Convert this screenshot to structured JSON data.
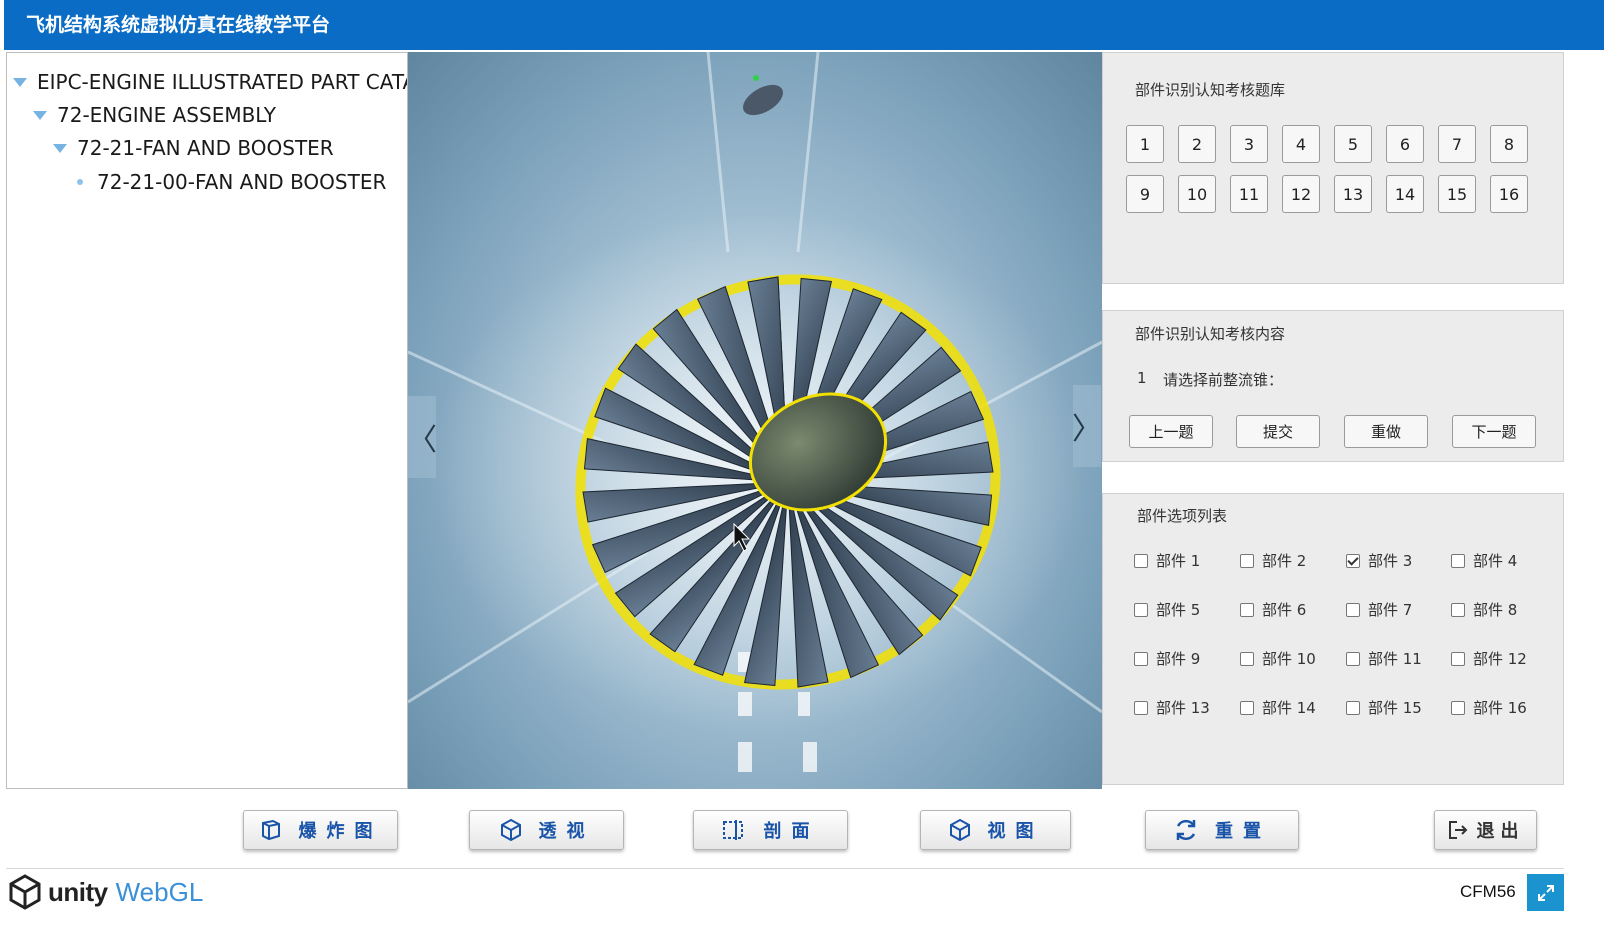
{
  "header": {
    "title": "飞机结构系统虚拟仿真在线教学平台"
  },
  "tree": {
    "items": [
      {
        "label": "EIPC-ENGINE ILLUSTRATED PART CATAL",
        "level": 0,
        "expanded": true
      },
      {
        "label": "72-ENGINE ASSEMBLY",
        "level": 1,
        "expanded": true
      },
      {
        "label": "72-21-FAN AND BOOSTER",
        "level": 2,
        "expanded": true
      },
      {
        "label": "72-21-00-FAN AND BOOSTER",
        "level": 3,
        "expanded": false
      }
    ]
  },
  "viewport": {
    "prev_label": "〈",
    "next_label": "〉"
  },
  "question_bank": {
    "title": "部件识别认知考核题库",
    "numbers": [
      "1",
      "2",
      "3",
      "4",
      "5",
      "6",
      "7",
      "8",
      "9",
      "10",
      "11",
      "12",
      "13",
      "14",
      "15",
      "16"
    ]
  },
  "question_content": {
    "title": "部件识别认知考核内容",
    "number": "1",
    "prompt": "请选择前整流锥：",
    "buttons": {
      "prev": "上一题",
      "submit": "提交",
      "redo": "重做",
      "next": "下一题"
    }
  },
  "options": {
    "title": "部件选项列表",
    "items": [
      {
        "label": "部件 1",
        "checked": false
      },
      {
        "label": "部件 2",
        "checked": false
      },
      {
        "label": "部件 3",
        "checked": true
      },
      {
        "label": "部件 4",
        "checked": false
      },
      {
        "label": "部件 5",
        "checked": false
      },
      {
        "label": "部件 6",
        "checked": false
      },
      {
        "label": "部件 7",
        "checked": false
      },
      {
        "label": "部件 8",
        "checked": false
      },
      {
        "label": "部件 9",
        "checked": false
      },
      {
        "label": "部件 10",
        "checked": false
      },
      {
        "label": "部件 11",
        "checked": false
      },
      {
        "label": "部件 12",
        "checked": false
      },
      {
        "label": "部件 13",
        "checked": false
      },
      {
        "label": "部件 14",
        "checked": false
      },
      {
        "label": "部件 15",
        "checked": false
      },
      {
        "label": "部件 16",
        "checked": false
      }
    ]
  },
  "toolbar": {
    "explode": "爆炸图",
    "perspective": "透视",
    "section": "剖面",
    "view": "视图",
    "reset": "重置",
    "exit": "退出"
  },
  "footer": {
    "unity": "unity",
    "webgl": "WebGL",
    "product": "CFM56"
  },
  "colors": {
    "header": "#0a6cc4",
    "accent": "#1a54a8",
    "highlight": "#f2e000"
  }
}
